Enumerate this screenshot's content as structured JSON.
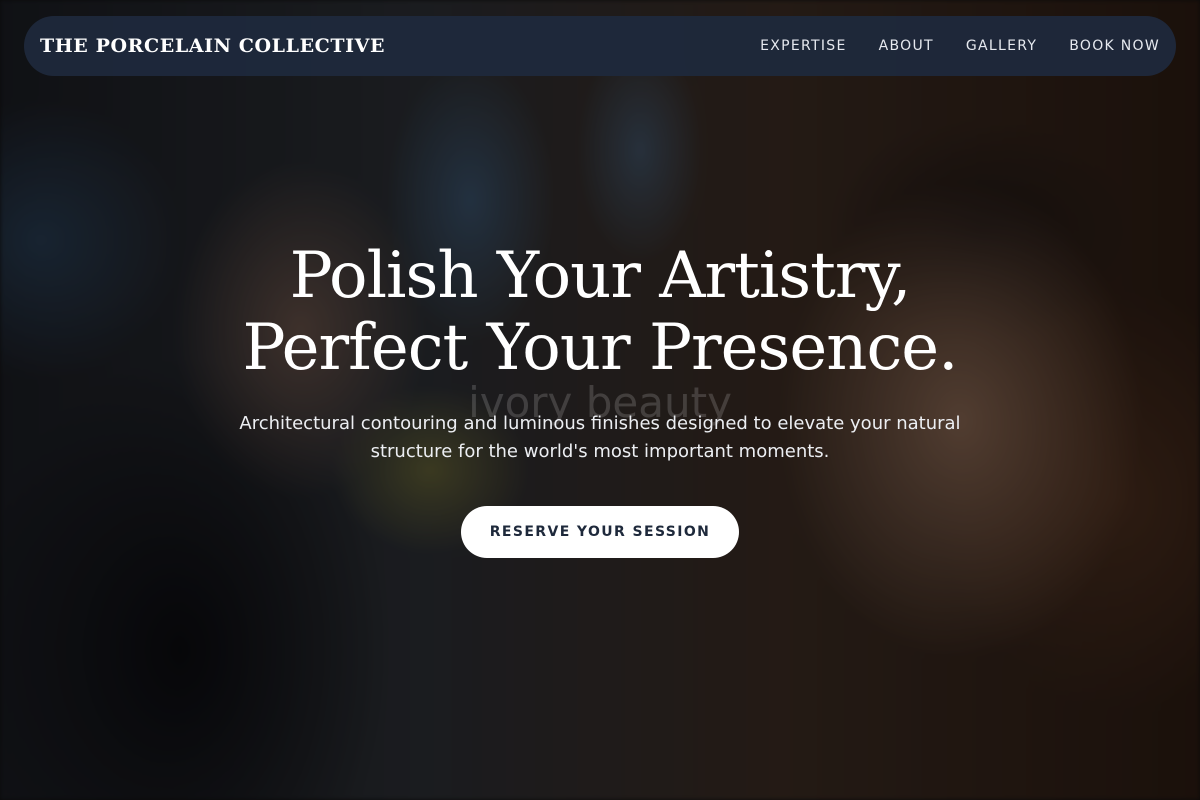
{
  "nav": {
    "brand": "THE PORCELAIN COLLECTIVE",
    "links": [
      {
        "label": "EXPERTISE"
      },
      {
        "label": "ABOUT"
      },
      {
        "label": "GALLERY"
      },
      {
        "label": "BOOK NOW"
      }
    ]
  },
  "hero": {
    "title_line1": "Polish Your Artistry,",
    "title_line2": "Perfect Your Presence.",
    "subtitle": "Architectural contouring and luminous finishes designed to elevate your natural structure for the world's most important moments.",
    "cta_label": "RESERVE YOUR SESSION",
    "watermark": "ivory beauty"
  },
  "colors": {
    "nav_bg": "#1e293b",
    "cta_bg": "#ffffff",
    "cta_text": "#1e293b",
    "text": "#ffffff"
  }
}
